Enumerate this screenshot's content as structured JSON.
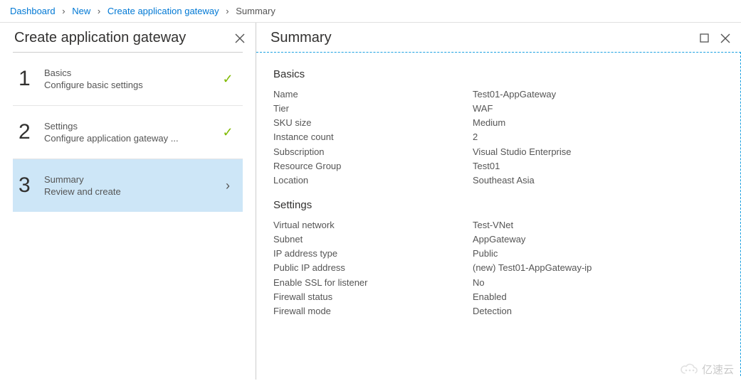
{
  "breadcrumb": {
    "items": [
      "Dashboard",
      "New",
      "Create application gateway",
      "Summary"
    ]
  },
  "leftPanel": {
    "title": "Create application gateway"
  },
  "steps": [
    {
      "num": "1",
      "title": "Basics",
      "sub": "Configure basic settings",
      "status": "done"
    },
    {
      "num": "2",
      "title": "Settings",
      "sub": "Configure application gateway ...",
      "status": "done"
    },
    {
      "num": "3",
      "title": "Summary",
      "sub": "Review and create",
      "status": "active"
    }
  ],
  "rightPanel": {
    "title": "Summary"
  },
  "sections": [
    {
      "heading": "Basics",
      "rows": [
        {
          "k": "Name",
          "v": "Test01-AppGateway"
        },
        {
          "k": "Tier",
          "v": "WAF"
        },
        {
          "k": "SKU size",
          "v": "Medium"
        },
        {
          "k": "Instance count",
          "v": "2"
        },
        {
          "k": "Subscription",
          "v": "Visual Studio Enterprise"
        },
        {
          "k": "Resource Group",
          "v": "Test01"
        },
        {
          "k": "Location",
          "v": "Southeast Asia"
        }
      ]
    },
    {
      "heading": "Settings",
      "rows": [
        {
          "k": "Virtual network",
          "v": "Test-VNet"
        },
        {
          "k": "Subnet",
          "v": "AppGateway"
        },
        {
          "k": "IP address type",
          "v": "Public"
        },
        {
          "k": "Public IP address",
          "v": "(new) Test01-AppGateway-ip"
        },
        {
          "k": "Enable SSL for listener",
          "v": "No"
        },
        {
          "k": "Firewall status",
          "v": "Enabled"
        },
        {
          "k": "Firewall mode",
          "v": "Detection"
        }
      ]
    }
  ],
  "watermark": "亿速云"
}
